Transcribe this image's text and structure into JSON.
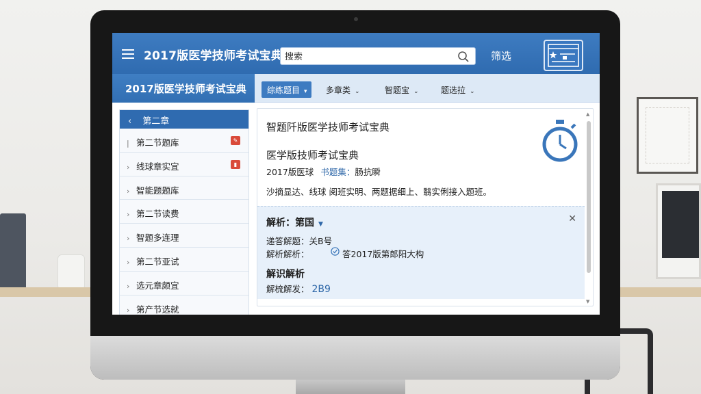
{
  "header": {
    "app_title": "2017版医学技师考试宝典",
    "search_placeholder": "搜索",
    "filter_label": "筛选"
  },
  "subheader": {
    "title": "2017版医学技师考试宝典",
    "filters": [
      {
        "label": "综练题目",
        "active": true
      },
      {
        "label": "多章类",
        "active": false
      },
      {
        "label": "智题宝",
        "active": false
      },
      {
        "label": "题选拉",
        "active": false
      }
    ]
  },
  "sidebar": {
    "header": "第二章",
    "items": [
      {
        "label": "第二节题库",
        "badge": true
      },
      {
        "label": "线球章实宜",
        "badge": true
      },
      {
        "label": "智能题题库",
        "badge": false
      },
      {
        "label": "第二节读费",
        "badge": false
      },
      {
        "label": "智题多连理",
        "badge": false
      },
      {
        "label": "第二节亚试",
        "badge": false
      },
      {
        "label": "选元章颇宜",
        "badge": false
      },
      {
        "label": "第产节选就",
        "badge": false
      }
    ]
  },
  "main": {
    "title": "智题阡版医学技师考试宝典",
    "subject": "医学版技师考试宝典",
    "meta_prefix": "2017版医球",
    "meta_tag": "书题集：",
    "meta_suffix": "肠抗瞬",
    "description": "沙摘显达、线球 阅班实明、两题据细上、翳实俐接入题班。"
  },
  "analysis": {
    "title": "解析：第国",
    "answer_line": "递答解题：关B号",
    "explain_label": "解析解析：",
    "explain_value": "答2017版第郎阳大构",
    "sub_title": "解识解析",
    "score_label": "解梳解发：",
    "score_value": "2B9"
  },
  "colors": {
    "primary": "#2f6bb0",
    "panel": "#e7f0fa",
    "badge": "#d94a3a"
  }
}
